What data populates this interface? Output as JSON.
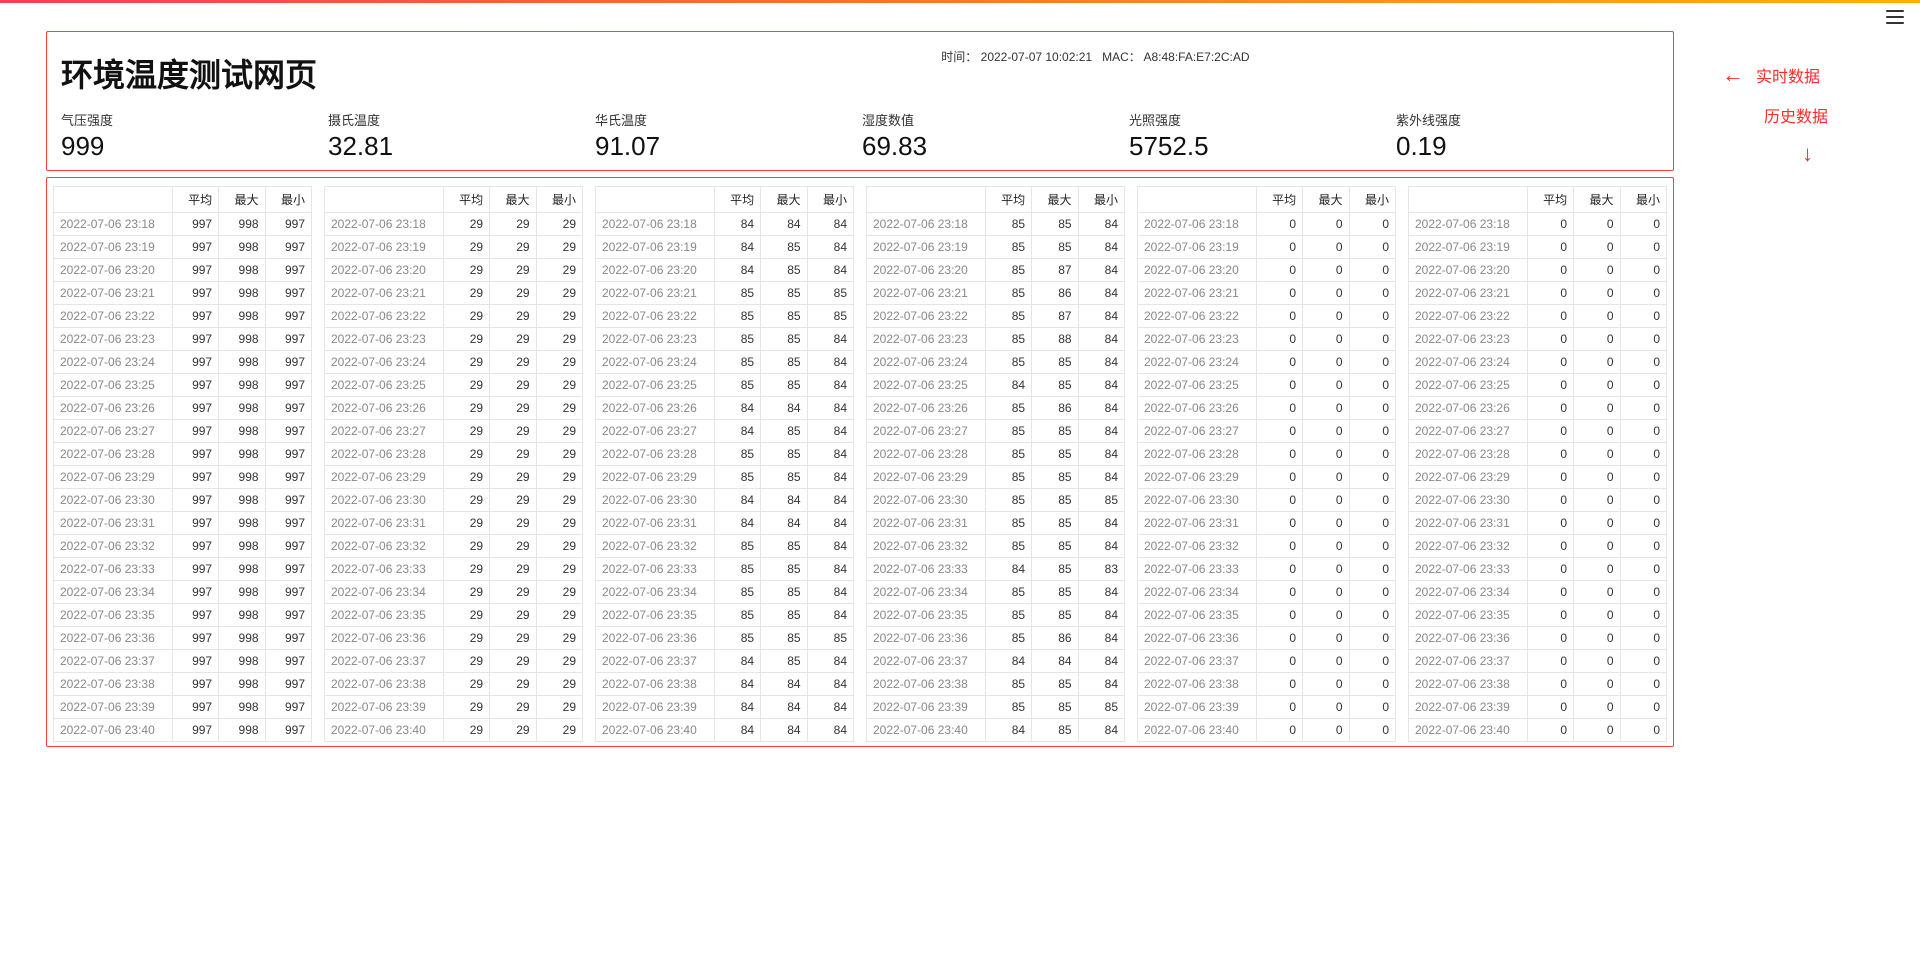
{
  "title": "环境温度测试网页",
  "meta": {
    "time_label": "时间：",
    "time_value": "2022-07-07 10:02:21",
    "mac_label": "MAC：",
    "mac_value": "A8:48:FA:E7:2C:AD"
  },
  "annotations": {
    "realtime": "实时数据",
    "history": "历史数据"
  },
  "metrics": {
    "pressure": {
      "label": "气压强度",
      "value": "999"
    },
    "celsius": {
      "label": "摄氏温度",
      "value": "32.81"
    },
    "fahrenheit": {
      "label": "华氏温度",
      "value": "91.07"
    },
    "humidity": {
      "label": "湿度数值",
      "value": "69.83"
    },
    "light": {
      "label": "光照强度",
      "value": "5752.5"
    },
    "uv": {
      "label": "紫外线强度",
      "value": "0.19"
    }
  },
  "headers": {
    "ts": "",
    "avg": "平均",
    "max": "最大",
    "min": "最小"
  },
  "timestamps": [
    "2022-07-06 23:18",
    "2022-07-06 23:19",
    "2022-07-06 23:20",
    "2022-07-06 23:21",
    "2022-07-06 23:22",
    "2022-07-06 23:23",
    "2022-07-06 23:24",
    "2022-07-06 23:25",
    "2022-07-06 23:26",
    "2022-07-06 23:27",
    "2022-07-06 23:28",
    "2022-07-06 23:29",
    "2022-07-06 23:30",
    "2022-07-06 23:31",
    "2022-07-06 23:32",
    "2022-07-06 23:33",
    "2022-07-06 23:34",
    "2022-07-06 23:35",
    "2022-07-06 23:36",
    "2022-07-06 23:37",
    "2022-07-06 23:38",
    "2022-07-06 23:39",
    "2022-07-06 23:40"
  ],
  "history": {
    "pressure": [
      [
        997,
        998,
        997
      ],
      [
        997,
        998,
        997
      ],
      [
        997,
        998,
        997
      ],
      [
        997,
        998,
        997
      ],
      [
        997,
        998,
        997
      ],
      [
        997,
        998,
        997
      ],
      [
        997,
        998,
        997
      ],
      [
        997,
        998,
        997
      ],
      [
        997,
        998,
        997
      ],
      [
        997,
        998,
        997
      ],
      [
        997,
        998,
        997
      ],
      [
        997,
        998,
        997
      ],
      [
        997,
        998,
        997
      ],
      [
        997,
        998,
        997
      ],
      [
        997,
        998,
        997
      ],
      [
        997,
        998,
        997
      ],
      [
        997,
        998,
        997
      ],
      [
        997,
        998,
        997
      ],
      [
        997,
        998,
        997
      ],
      [
        997,
        998,
        997
      ],
      [
        997,
        998,
        997
      ],
      [
        997,
        998,
        997
      ],
      [
        997,
        998,
        997
      ]
    ],
    "celsius": [
      [
        29,
        29,
        29
      ],
      [
        29,
        29,
        29
      ],
      [
        29,
        29,
        29
      ],
      [
        29,
        29,
        29
      ],
      [
        29,
        29,
        29
      ],
      [
        29,
        29,
        29
      ],
      [
        29,
        29,
        29
      ],
      [
        29,
        29,
        29
      ],
      [
        29,
        29,
        29
      ],
      [
        29,
        29,
        29
      ],
      [
        29,
        29,
        29
      ],
      [
        29,
        29,
        29
      ],
      [
        29,
        29,
        29
      ],
      [
        29,
        29,
        29
      ],
      [
        29,
        29,
        29
      ],
      [
        29,
        29,
        29
      ],
      [
        29,
        29,
        29
      ],
      [
        29,
        29,
        29
      ],
      [
        29,
        29,
        29
      ],
      [
        29,
        29,
        29
      ],
      [
        29,
        29,
        29
      ],
      [
        29,
        29,
        29
      ],
      [
        29,
        29,
        29
      ]
    ],
    "fahrenheit": [
      [
        84,
        84,
        84
      ],
      [
        84,
        85,
        84
      ],
      [
        84,
        85,
        84
      ],
      [
        85,
        85,
        85
      ],
      [
        85,
        85,
        85
      ],
      [
        85,
        85,
        84
      ],
      [
        85,
        85,
        84
      ],
      [
        85,
        85,
        84
      ],
      [
        84,
        84,
        84
      ],
      [
        84,
        85,
        84
      ],
      [
        85,
        85,
        84
      ],
      [
        85,
        85,
        84
      ],
      [
        84,
        84,
        84
      ],
      [
        84,
        84,
        84
      ],
      [
        85,
        85,
        84
      ],
      [
        85,
        85,
        84
      ],
      [
        85,
        85,
        84
      ],
      [
        85,
        85,
        84
      ],
      [
        85,
        85,
        85
      ],
      [
        84,
        85,
        84
      ],
      [
        84,
        84,
        84
      ],
      [
        84,
        84,
        84
      ],
      [
        84,
        84,
        84
      ]
    ],
    "humidity": [
      [
        85,
        85,
        84
      ],
      [
        85,
        85,
        84
      ],
      [
        85,
        87,
        84
      ],
      [
        85,
        86,
        84
      ],
      [
        85,
        87,
        84
      ],
      [
        85,
        88,
        84
      ],
      [
        85,
        85,
        84
      ],
      [
        84,
        85,
        84
      ],
      [
        85,
        86,
        84
      ],
      [
        85,
        85,
        84
      ],
      [
        85,
        85,
        84
      ],
      [
        85,
        85,
        84
      ],
      [
        85,
        85,
        85
      ],
      [
        85,
        85,
        84
      ],
      [
        85,
        85,
        84
      ],
      [
        84,
        85,
        83
      ],
      [
        85,
        85,
        84
      ],
      [
        85,
        85,
        84
      ],
      [
        85,
        86,
        84
      ],
      [
        84,
        84,
        84
      ],
      [
        85,
        85,
        84
      ],
      [
        85,
        85,
        85
      ],
      [
        84,
        85,
        84
      ]
    ],
    "light": [
      [
        0,
        0,
        0
      ],
      [
        0,
        0,
        0
      ],
      [
        0,
        0,
        0
      ],
      [
        0,
        0,
        0
      ],
      [
        0,
        0,
        0
      ],
      [
        0,
        0,
        0
      ],
      [
        0,
        0,
        0
      ],
      [
        0,
        0,
        0
      ],
      [
        0,
        0,
        0
      ],
      [
        0,
        0,
        0
      ],
      [
        0,
        0,
        0
      ],
      [
        0,
        0,
        0
      ],
      [
        0,
        0,
        0
      ],
      [
        0,
        0,
        0
      ],
      [
        0,
        0,
        0
      ],
      [
        0,
        0,
        0
      ],
      [
        0,
        0,
        0
      ],
      [
        0,
        0,
        0
      ],
      [
        0,
        0,
        0
      ],
      [
        0,
        0,
        0
      ],
      [
        0,
        0,
        0
      ],
      [
        0,
        0,
        0
      ],
      [
        0,
        0,
        0
      ]
    ],
    "uv": [
      [
        0,
        0,
        0
      ],
      [
        0,
        0,
        0
      ],
      [
        0,
        0,
        0
      ],
      [
        0,
        0,
        0
      ],
      [
        0,
        0,
        0
      ],
      [
        0,
        0,
        0
      ],
      [
        0,
        0,
        0
      ],
      [
        0,
        0,
        0
      ],
      [
        0,
        0,
        0
      ],
      [
        0,
        0,
        0
      ],
      [
        0,
        0,
        0
      ],
      [
        0,
        0,
        0
      ],
      [
        0,
        0,
        0
      ],
      [
        0,
        0,
        0
      ],
      [
        0,
        0,
        0
      ],
      [
        0,
        0,
        0
      ],
      [
        0,
        0,
        0
      ],
      [
        0,
        0,
        0
      ],
      [
        0,
        0,
        0
      ],
      [
        0,
        0,
        0
      ],
      [
        0,
        0,
        0
      ],
      [
        0,
        0,
        0
      ],
      [
        0,
        0,
        0
      ]
    ]
  }
}
